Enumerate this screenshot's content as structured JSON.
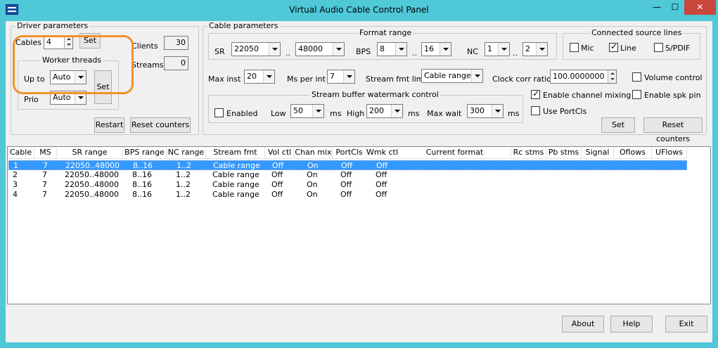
{
  "window": {
    "title": "Virtual Audio Cable Control Panel",
    "min": "—",
    "max": "☐",
    "close": "✕"
  },
  "driver": {
    "group_title": "Driver parameters",
    "cables_label": "Cables",
    "cables_value": "4",
    "set_label": "Set",
    "clients_label": "Clients",
    "clients_value": "30",
    "streams_label": "Streams",
    "streams_value": "0",
    "worker": {
      "group_title": "Worker threads",
      "upto_label": "Up to",
      "upto_value": "Auto",
      "prio_label": "Prio",
      "prio_value": "Auto",
      "set_label": "Set"
    },
    "restart_label": "Restart",
    "reset_label": "Reset counters"
  },
  "cable": {
    "group_title": "Cable parameters",
    "format_title": "Format range",
    "sr_label": "SR",
    "sr_min": "22050",
    "sr_max": "48000",
    "dots": "..",
    "bps_label": "BPS",
    "bps_min": "8",
    "bps_max": "16",
    "nc_label": "NC",
    "nc_min": "1",
    "nc_max": "2",
    "sources_title": "Connected source lines",
    "mic_label": "Mic",
    "line_label": "Line",
    "spdif_label": "S/PDIF",
    "maxinst_label": "Max inst",
    "maxinst_value": "20",
    "msperint_label": "Ms per int",
    "msperint_value": "7",
    "streamfmt_label": "Stream fmt limit",
    "streamfmt_value": "Cable range",
    "clockcorr_label": "Clock corr ratio",
    "clockcorr_value": "100.0000000",
    "volume_label": "Volume control",
    "watermark_title": "Stream buffer watermark control",
    "enabled_label": "Enabled",
    "low_label": "Low",
    "low_value": "50",
    "ms1": "ms",
    "high_label": "High",
    "high_value": "200",
    "ms2": "ms",
    "maxwait_label": "Max wait",
    "maxwait_value": "300",
    "ms3": "ms",
    "chanmix_label": "Enable channel mixing",
    "spkpin_label": "Enable spk pin",
    "portcls_label": "Use PortCls",
    "set_label": "Set",
    "reset_label": "Reset counters"
  },
  "list": {
    "columns": [
      "Cable",
      "MS",
      "SR range",
      "BPS range",
      "NC range",
      "Stream fmt limit",
      "Vol ctl",
      "Chan mix",
      "PortCls",
      "Wmk ctl",
      "Current format",
      "Rc stms",
      "Pb stms",
      "Signal",
      "Oflows",
      "UFlows"
    ],
    "rows": [
      [
        "1",
        "7",
        "22050..48000",
        "8..16",
        "1..2",
        "Cable range",
        "Off",
        "On",
        "Off",
        "Off"
      ],
      [
        "2",
        "7",
        "22050..48000",
        "8..16",
        "1..2",
        "Cable range",
        "Off",
        "On",
        "Off",
        "Off"
      ],
      [
        "3",
        "7",
        "22050..48000",
        "8..16",
        "1..2",
        "Cable range",
        "Off",
        "On",
        "Off",
        "Off"
      ],
      [
        "4",
        "7",
        "22050..48000",
        "8..16",
        "1..2",
        "Cable range",
        "Off",
        "On",
        "Off",
        "Off"
      ]
    ]
  },
  "footer": {
    "about": "About",
    "help": "Help",
    "exit": "Exit"
  }
}
